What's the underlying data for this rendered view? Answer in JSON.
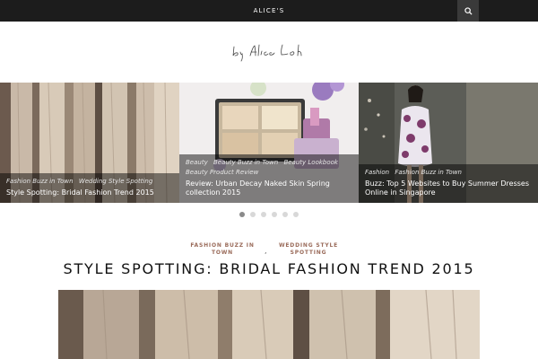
{
  "header": {
    "site_name": "ALICE'S",
    "search_icon": "search-icon"
  },
  "logo": {
    "text": "by Alice Loh"
  },
  "slides": [
    {
      "categories": [
        "Fashion Buzz in Town",
        "Wedding Style Spotting"
      ],
      "title": "Style Spotting: Bridal Fashion Trend 2015"
    },
    {
      "categories": [
        "Beauty",
        "Beauty Buzz in Town",
        "Beauty Lookbook",
        "Beauty Product Review"
      ],
      "title": "Review: Urban Decay Naked Skin Spring collection 2015"
    },
    {
      "categories": [
        "Fashion",
        "Fashion Buzz in Town"
      ],
      "title": "Buzz: Top 5 Websites to Buy Summer Dresses Online in Singapore"
    }
  ],
  "slider": {
    "dot_count": 6,
    "active_index": 0
  },
  "post": {
    "category_1": "FASHION BUZZ IN TOWN",
    "category_2": "WEDDING STYLE SPOTTING",
    "separator": ",",
    "title": "STYLE SPOTTING: BRIDAL FASHION TREND 2015"
  },
  "colors": {
    "topbar": "#1c1c1c",
    "category_accent": "#9a6b5a"
  }
}
